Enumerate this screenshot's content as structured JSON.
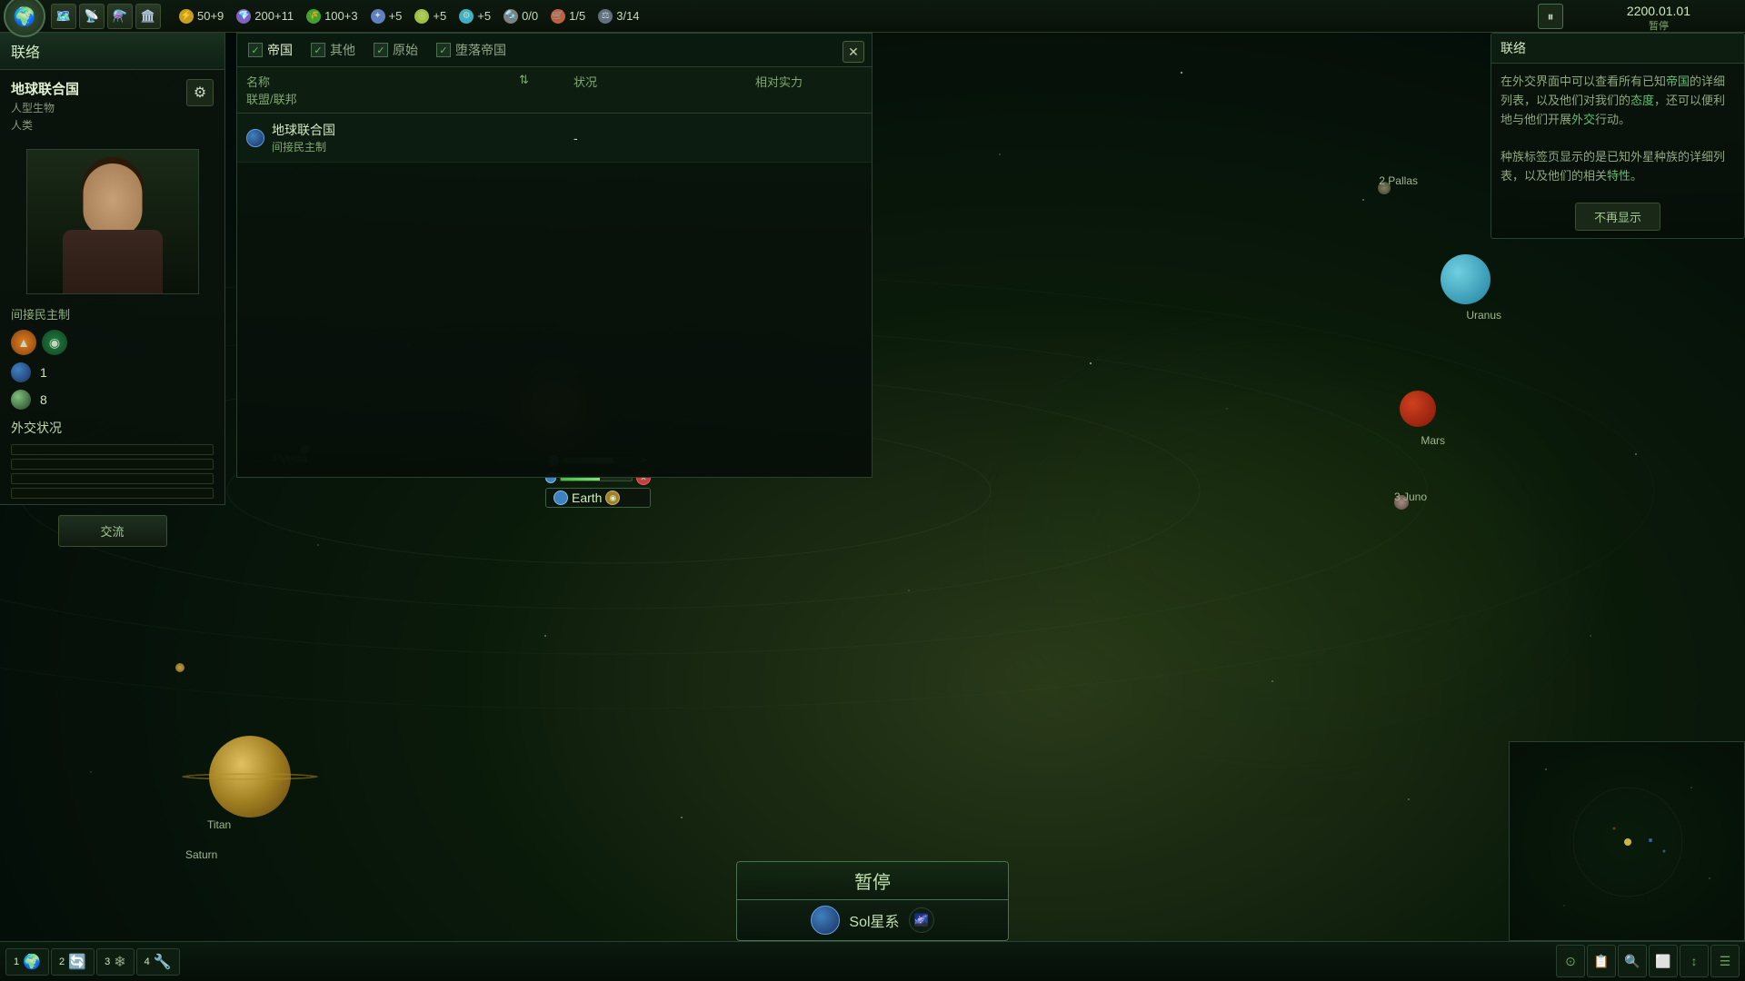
{
  "topbar": {
    "empire_icon_text": "🌍",
    "icons": [
      "🗺️",
      "📡",
      "⚗️",
      "🏛️"
    ],
    "resources": {
      "energy": {
        "value": "50+9",
        "icon": "⚡"
      },
      "minerals": {
        "value": "200+11",
        "icon": "💎"
      },
      "food": {
        "value": "100+3",
        "icon": "🌾"
      },
      "influence": {
        "value": "+5",
        "icon": "✦"
      },
      "unity": {
        "value": "+5",
        "icon": "◎"
      },
      "tech": {
        "value": "+5",
        "icon": "⚙"
      },
      "alloys": {
        "value": "0/0",
        "icon": "🔩"
      },
      "consumer": {
        "value": "1/5",
        "icon": "🛒"
      },
      "stability": {
        "value": "3/14",
        "icon": "📊"
      }
    },
    "pause_icon": "⏸",
    "date": "2200.01.01",
    "date_sub": "暂停"
  },
  "left_panel": {
    "title": "联络",
    "empire_name": "地球联合国",
    "empire_type1": "人型生物",
    "empire_type2": "人类",
    "gov_type": "间接民主制",
    "planet_count": "1",
    "pop_count": "8",
    "diplo_title": "外交状况",
    "exchange_btn": "交流"
  },
  "dialog": {
    "title": "联络",
    "tabs": [
      {
        "label": "帝国",
        "checked": true
      },
      {
        "label": "其他",
        "checked": true
      },
      {
        "label": "原始",
        "checked": true
      },
      {
        "label": "堕落帝国",
        "checked": true
      }
    ],
    "columns": [
      "名称",
      "",
      "状况",
      "相对实力",
      "联盟/联邦"
    ],
    "rows": [
      {
        "flag": "🌍",
        "name": "地球联合国",
        "gov": "间接民主制",
        "status": "-",
        "power": "",
        "alliance": ""
      }
    ],
    "close_btn": "✕"
  },
  "right_panel": {
    "title": "联络",
    "info_text1": "在外交界面中可以查看所有已知",
    "highlight1": "帝国",
    "info_text2": "的详细列表，以及他们对我们的",
    "highlight2": "态度",
    "info_text3": "，还可以便利地与他们开展",
    "highlight3": "外交",
    "info_text4": "行动。",
    "info_text5": "种族标签页显示的是已知外星种族的详细列表，以及他们的相关",
    "highlight4": "特性",
    "info_text6": "。",
    "no_show_btn": "不再显示",
    "uranus_label": "Uranus",
    "pallas_label": "2 Pallas"
  },
  "space": {
    "earth_label": "Earth",
    "saturn_label": "Saturn",
    "titan_label": "Titan",
    "vesta_label": "4 Vesta",
    "mars_label": "Mars",
    "juno_label": "3 Juno"
  },
  "pause_display": {
    "label": "暂停",
    "system_label": "Sol星系"
  },
  "bottom_bar": {
    "tabs": [
      {
        "num": "1",
        "icon": "🌍",
        "label": ""
      },
      {
        "num": "2",
        "icon": "🔄",
        "label": ""
      },
      {
        "num": "3",
        "icon": "❄",
        "label": ""
      },
      {
        "num": "4",
        "icon": "🔧",
        "label": ""
      }
    ]
  }
}
